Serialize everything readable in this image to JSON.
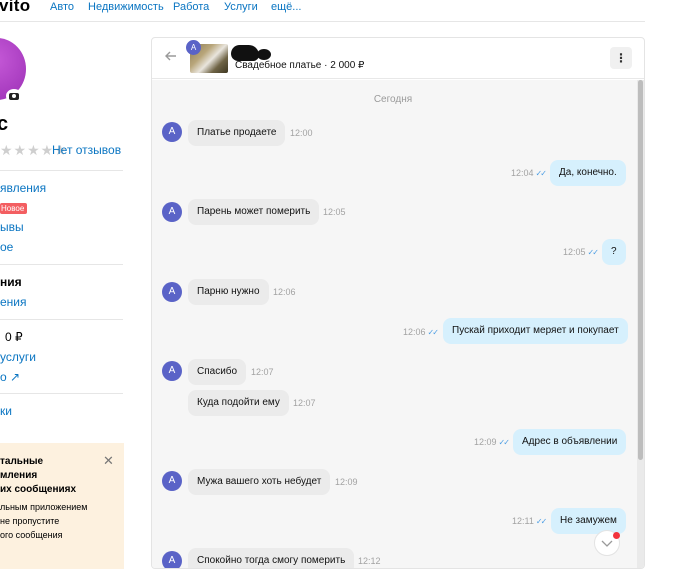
{
  "nav": {
    "logo": "vito",
    "links": [
      "Авто",
      "Недвижимость",
      "Работа",
      "Услуги",
      "ещё..."
    ]
  },
  "sidebar": {
    "username": "с",
    "stars": "★★★★★",
    "no_reviews": "Нет отзывов",
    "items": [
      "явления",
      "Новое",
      "ывы",
      "ое",
      "ния",
      "ения",
      "0 ₽",
      "услуги",
      "о ↗",
      "ки"
    ],
    "promo": {
      "title_lines": [
        "тальные",
        "мления",
        "их сообщениях"
      ],
      "text_lines": [
        "льным приложением",
        "не пропустите",
        "ого сообщения"
      ],
      "close": "✕"
    }
  },
  "chat": {
    "header": {
      "back_icon": "arrow-left-icon",
      "avatar_letter": "A",
      "subject": "Свадебное платье · 2 000 ₽",
      "menu_icon": "⋮"
    },
    "date_separator": "Сегодня",
    "messages": [
      {
        "dir": "in",
        "text": "Платье продаете",
        "time": "12:00",
        "avatar": "A"
      },
      {
        "dir": "out",
        "text": "Да, конечно.",
        "time": "12:04"
      },
      {
        "dir": "in",
        "text": "Парень может померить",
        "time": "12:05",
        "avatar": "A"
      },
      {
        "dir": "out",
        "text": "?",
        "time": "12:05"
      },
      {
        "dir": "in",
        "text": "Парню нужно",
        "time": "12:06",
        "avatar": "A"
      },
      {
        "dir": "out",
        "text": "Пускай приходит меряет и покупает",
        "time": "12:06"
      },
      {
        "dir": "in",
        "text": "Спасибо",
        "time": "12:07",
        "avatar": "A"
      },
      {
        "dir": "in",
        "text": "Куда подойти ему",
        "time": "12:07"
      },
      {
        "dir": "out",
        "text": "Адрес в объявлении",
        "time": "12:09"
      },
      {
        "dir": "in",
        "text": "Мужа вашего хоть небудет",
        "time": "12:09",
        "avatar": "A"
      },
      {
        "dir": "out",
        "text": "Не замужем",
        "time": "12:11"
      },
      {
        "dir": "in",
        "text": "Спокойно тогда смогу померить",
        "time": "12:12",
        "avatar": "A"
      }
    ],
    "read_ticks": "✓✓",
    "scroll_down_icon": "chevron-down-icon"
  },
  "colors": {
    "link": "#0a75c2",
    "incoming_bubble": "#ebebeb",
    "outgoing_bubble": "#d6f0fd",
    "avatar": "#5a63c7",
    "badge_new": "#f35e61",
    "promo_bg": "#fdf1df"
  }
}
